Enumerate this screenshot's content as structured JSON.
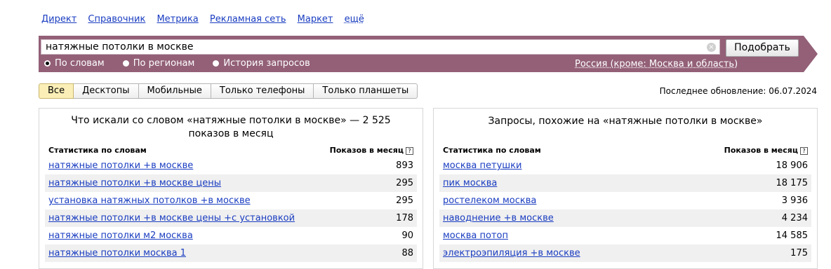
{
  "nav": {
    "links": [
      "Директ",
      "Справочник",
      "Метрика",
      "Рекламная сеть",
      "Маркет"
    ],
    "more": "ещё"
  },
  "search": {
    "value": "натяжные потолки в москве",
    "clear_icon": "close-circle-icon",
    "submit_label": "Подобрать",
    "modes": [
      {
        "label": "По словам",
        "checked": true
      },
      {
        "label": "По регионам",
        "checked": false
      },
      {
        "label": "История запросов",
        "checked": false
      }
    ],
    "region": "Россия (кроме: Москва и область)"
  },
  "filters": {
    "tabs": [
      {
        "label": "Все",
        "active": true
      },
      {
        "label": "Десктопы",
        "active": false
      },
      {
        "label": "Мобильные",
        "active": false
      },
      {
        "label": "Только телефоны",
        "active": false
      },
      {
        "label": "Только планшеты",
        "active": false
      }
    ],
    "updated": "Последнее обновление: 06.07.2024"
  },
  "left_panel": {
    "title": "Что искали со словом «натяжные потолки в москве» — 2 525 показов в месяц",
    "col_phrase": "Статистика по словам",
    "col_count": "Показов в месяц",
    "rows": [
      {
        "phrase": "натяжные потолки +в москве",
        "count": "893"
      },
      {
        "phrase": "натяжные потолки +в москве цены",
        "count": "295"
      },
      {
        "phrase": "установка натяжных потолков +в москве",
        "count": "295"
      },
      {
        "phrase": "натяжные потолки +в москве цены +с установкой",
        "count": "178"
      },
      {
        "phrase": "натяжные потолки м2 москва",
        "count": "90"
      },
      {
        "phrase": "натяжные потолки москва 1",
        "count": "88"
      }
    ]
  },
  "right_panel": {
    "title": "Запросы, похожие на «натяжные потолки в москве»",
    "col_phrase": "Статистика по словам",
    "col_count": "Показов в месяц",
    "rows": [
      {
        "phrase": "москва петушки",
        "count": "18 906"
      },
      {
        "phrase": "пик москва",
        "count": "18 175"
      },
      {
        "phrase": "ростелеком москва",
        "count": "3 936"
      },
      {
        "phrase": "наводнение +в москве",
        "count": "4 234"
      },
      {
        "phrase": "москва потоп",
        "count": "14 585"
      },
      {
        "phrase": "электроэпиляция +в москве",
        "count": "175"
      }
    ]
  },
  "colors": {
    "band": "#936077",
    "link": "#1a3dc1",
    "active_tab": "#fbefb7",
    "row_alt": "#f0f0f0"
  }
}
